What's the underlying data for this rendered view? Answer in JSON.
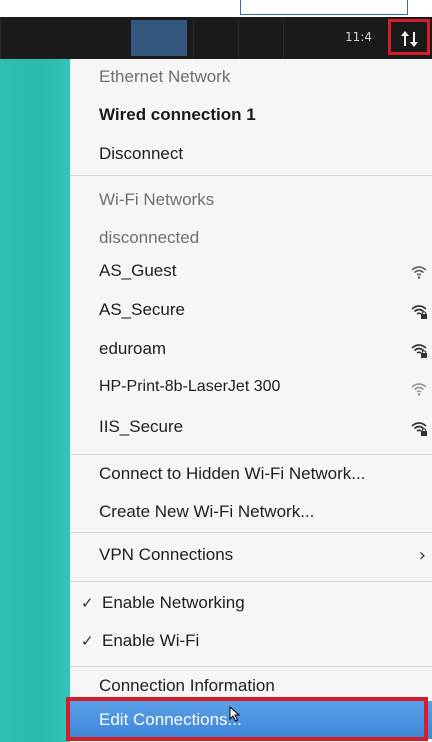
{
  "panel": {
    "clock": "11:4",
    "network_icon": "network-up-down-icon"
  },
  "menu": {
    "ethernet_header": "Ethernet Network",
    "wired_connection": "Wired connection 1",
    "disconnect": "Disconnect",
    "wifi_header": "Wi-Fi Networks",
    "wifi_status": "disconnected",
    "wifi_networks": [
      {
        "name": "AS_Guest",
        "icon": "wifi-open-icon"
      },
      {
        "name": "AS_Secure",
        "icon": "wifi-locked-icon"
      },
      {
        "name": "eduroam",
        "icon": "wifi-locked-icon"
      },
      {
        "name": "HP-Print-8b-LaserJet 300",
        "icon": "wifi-open-icon"
      },
      {
        "name": "IIS_Secure",
        "icon": "wifi-locked-icon"
      }
    ],
    "connect_hidden": "Connect to Hidden Wi-Fi Network...",
    "create_new": "Create New Wi-Fi Network...",
    "vpn_connections": "VPN Connections",
    "enable_networking": "Enable Networking",
    "enable_wifi": "Enable Wi-Fi",
    "connection_information": "Connection Information",
    "edit_connections": "Edit Connections..."
  }
}
